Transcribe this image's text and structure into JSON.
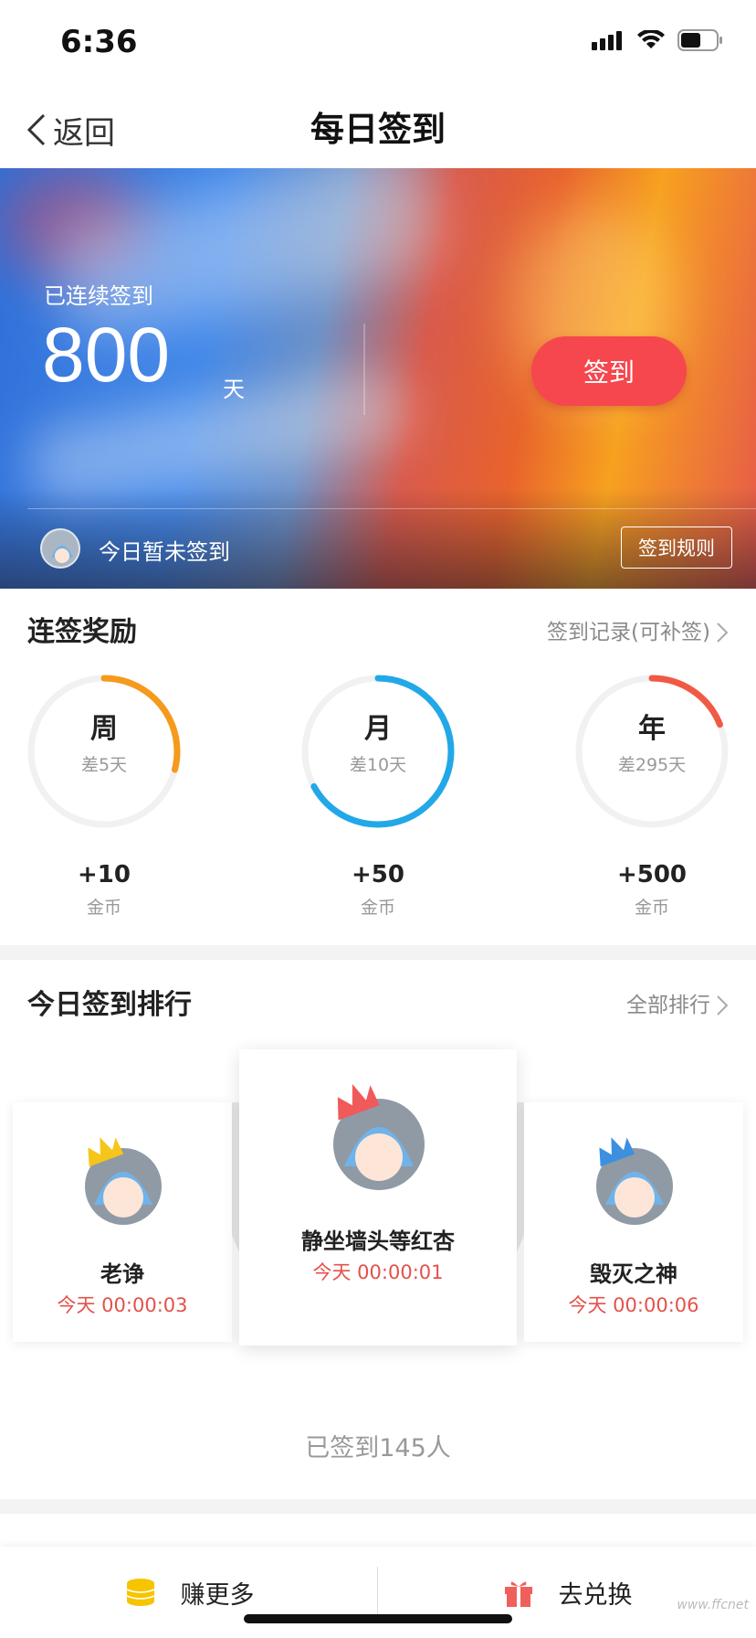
{
  "status_bar": {
    "time": "6:36"
  },
  "nav": {
    "back_label": "返回",
    "title": "每日签到"
  },
  "banner": {
    "streak_label": "已连续签到",
    "streak_days": "800",
    "streak_unit": "天",
    "checkin_button": "签到",
    "today_status": "今日暂未签到",
    "rules_button": "签到规则",
    "accent_color": "#f5474d"
  },
  "rewards": {
    "title": "连签奖励",
    "history_link": "签到记录(可补签)",
    "items": [
      {
        "period": "周",
        "remaining": "差5天",
        "coins": "+10",
        "unit": "金币",
        "progress": 0.29,
        "color": "#f59a1b"
      },
      {
        "period": "月",
        "remaining": "差10天",
        "coins": "+50",
        "unit": "金币",
        "progress": 0.67,
        "color": "#22a8e8"
      },
      {
        "period": "年",
        "remaining": "差295天",
        "coins": "+500",
        "unit": "金币",
        "progress": 0.19,
        "color": "#f05a44"
      }
    ]
  },
  "ranking": {
    "title": "今日签到排行",
    "all_link": "全部排行",
    "users": [
      {
        "name": "老诤",
        "time": "今天 00:00:03",
        "crown": "#f6c51a"
      },
      {
        "name": "静坐墙头等红杏",
        "time": "今天 00:00:01",
        "crown": "#f05a5a"
      },
      {
        "name": "毁灭之神",
        "time": "今天 00:00:06",
        "crown": "#3d8fe0"
      }
    ],
    "total": "已签到145人"
  },
  "bottom_tabs": {
    "earn_label": "赚更多",
    "redeem_label": "去兑换"
  },
  "watermark": "www.ffcnet"
}
